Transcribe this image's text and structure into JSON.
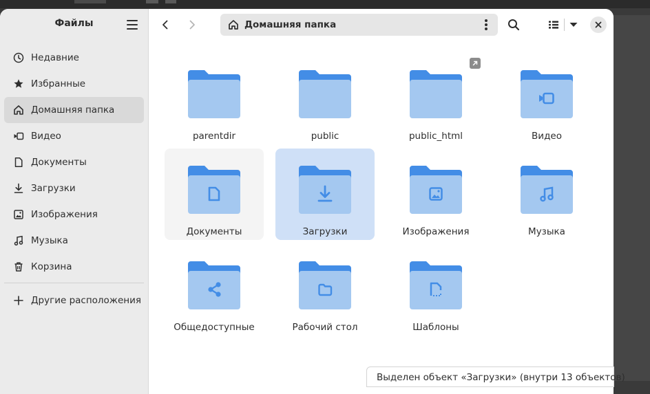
{
  "sidebar": {
    "title": "Файлы",
    "items": [
      {
        "label": "Недавние",
        "icon": "clock-icon"
      },
      {
        "label": "Избранные",
        "icon": "star-icon"
      },
      {
        "label": "Домашняя папка",
        "icon": "home-icon",
        "active": true
      },
      {
        "label": "Видео",
        "icon": "video-icon"
      },
      {
        "label": "Документы",
        "icon": "document-icon"
      },
      {
        "label": "Загрузки",
        "icon": "download-icon"
      },
      {
        "label": "Изображения",
        "icon": "image-icon"
      },
      {
        "label": "Музыка",
        "icon": "music-icon"
      },
      {
        "label": "Корзина",
        "icon": "trash-icon"
      }
    ],
    "other_locations": {
      "label": "Другие расположения",
      "icon": "plus-icon"
    }
  },
  "header": {
    "path_label": "Домашняя папка"
  },
  "files": [
    {
      "name": "parentdir",
      "emblem": "none"
    },
    {
      "name": "public",
      "emblem": "none"
    },
    {
      "name": "public_html",
      "emblem": "none",
      "symlink": true
    },
    {
      "name": "Видео",
      "emblem": "video"
    },
    {
      "name": "Документы",
      "emblem": "document",
      "state": "hover"
    },
    {
      "name": "Загрузки",
      "emblem": "download",
      "state": "selected"
    },
    {
      "name": "Изображения",
      "emblem": "image"
    },
    {
      "name": "Музыка",
      "emblem": "music"
    },
    {
      "name": "Общедоступные",
      "emblem": "share"
    },
    {
      "name": "Рабочий стол",
      "emblem": "desktop"
    },
    {
      "name": "Шаблоны",
      "emblem": "template"
    }
  ],
  "status": "Выделен объект «Загрузки» (внутри 13 объектов)",
  "colors": {
    "folder_back": "#438de6",
    "folder_front": "#a4c8f0",
    "emblem": "#438de6",
    "selection": "#cfe0f7"
  }
}
